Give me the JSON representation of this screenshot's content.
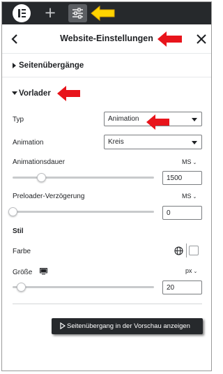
{
  "toolbar": {
    "add_label": "+"
  },
  "header": {
    "title": "Website-Einstellungen"
  },
  "sections": {
    "transitions": {
      "title": "Seitenübergänge",
      "expanded": false
    },
    "preloader": {
      "title": "Vorlader",
      "expanded": true
    }
  },
  "preloader": {
    "type": {
      "label": "Typ",
      "value": "Animation"
    },
    "animation": {
      "label": "Animation",
      "value": "Kreis"
    },
    "duration": {
      "label": "Animationsdauer",
      "unit": "MS",
      "value": "1500",
      "level": 0.2
    },
    "delay": {
      "label": "Preloader-Verzögerung",
      "unit": "MS",
      "value": "0",
      "level": 0.0
    },
    "style_heading": "Stil",
    "color": {
      "label": "Farbe",
      "value": "#ffffff"
    },
    "size": {
      "label": "Größe",
      "unit": "px",
      "value": "20",
      "level": 0.06
    }
  },
  "preview_button": {
    "label": "Seitenübergang in der Vorschau anzeigen"
  },
  "colors": {
    "toolbar_bg": "#26292c",
    "annotation_red": "#e8141b",
    "annotation_yellow": "#ffd400"
  }
}
